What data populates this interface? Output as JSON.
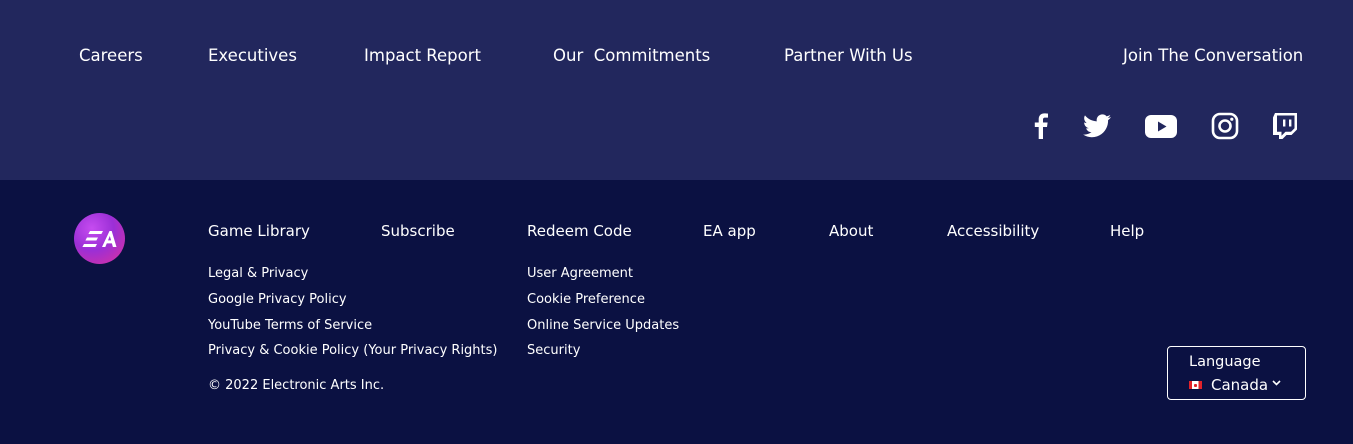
{
  "top_nav": {
    "careers": "Careers",
    "executives": "Executives",
    "impact_report": "Impact Report",
    "our_commitments": "Our  Commitments",
    "partner": "Partner With Us",
    "join": "Join The Conversation"
  },
  "social": {
    "icons": [
      "facebook-icon",
      "twitter-icon",
      "youtube-icon",
      "instagram-icon",
      "twitch-icon"
    ]
  },
  "footer": {
    "logo_text": "EA",
    "main_links": {
      "game_library": "Game Library",
      "subscribe": "Subscribe",
      "redeem_code": "Redeem Code",
      "ea_app": "EA app",
      "about": "About",
      "accessibility": "Accessibility",
      "help": "Help"
    },
    "legal_links": [
      "Legal & Privacy",
      "Google Privacy Policy",
      "YouTube Terms of Service",
      "Privacy & Cookie Policy (Your Privacy Rights)"
    ],
    "legal_links_2": [
      "User Agreement",
      "Cookie Preference",
      "Online Service Updates",
      "Security"
    ],
    "copyright": "© 2022 Electronic Arts Inc."
  },
  "language": {
    "label": "Language",
    "value": "Canada"
  },
  "colors": {
    "top_bg": "#22275d",
    "bottom_bg": "#0b1142",
    "text": "#ffffff"
  }
}
